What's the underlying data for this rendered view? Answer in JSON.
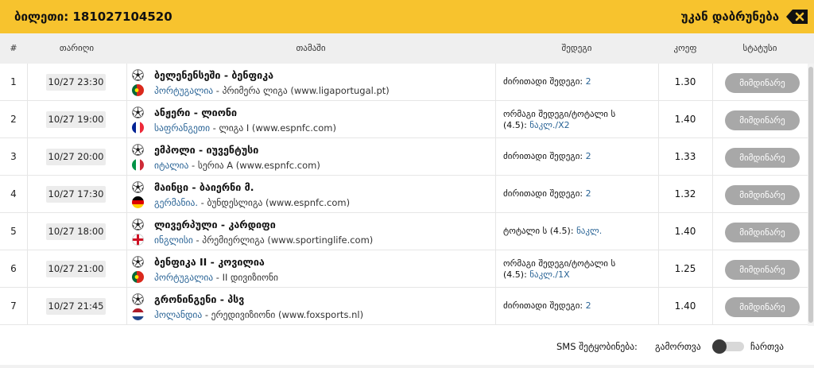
{
  "header": {
    "ticket": "ბილეთი: 181027104520",
    "back_label": "უკან დაბრუნება",
    "back_icon": "backspace-icon"
  },
  "columns": {
    "num": "#",
    "date": "თარიღი",
    "match": "თამაში",
    "result": "შედეგი",
    "coef": "კოეფ",
    "status": "სტატუსი"
  },
  "rows": [
    {
      "num": "1",
      "date": "10/27 23:30",
      "match": "ბელენენსეში - ბენფიკა",
      "country": "პორტუგალია",
      "league": " - პრიმერა ლიგა (www.ligaportugal.pt)",
      "flag": "portugal",
      "res1": "ძირითადი შედეგი: ",
      "val1": "2",
      "res2": "",
      "val2": "",
      "coef": "1.30",
      "status": "მიმდინარე"
    },
    {
      "num": "2",
      "date": "10/27 19:00",
      "match": "ანჟერი - ლიონი",
      "country": "საფრანგეთი",
      "league": " - ლიგა I (www.espnfc.com)",
      "flag": "france",
      "res1": "ორმაგი შედეგი/ტოტალი ს",
      "val1": "",
      "res2": "(4.5): ",
      "val2": "ნაკლ./X2",
      "coef": "1.40",
      "status": "მიმდინარე"
    },
    {
      "num": "3",
      "date": "10/27 20:00",
      "match": "ემპოლი - იუვენტუსი",
      "country": "იტალია",
      "league": " - სერია A (www.espnfc.com)",
      "flag": "italy",
      "res1": "ძირითადი შედეგი: ",
      "val1": "2",
      "res2": "",
      "val2": "",
      "coef": "1.33",
      "status": "მიმდინარე"
    },
    {
      "num": "4",
      "date": "10/27 17:30",
      "match": "მაინცი - ბაიერნი მ.",
      "country": "გერმანია.",
      "league": " - ბუნდესლიგა (www.espnfc.com)",
      "flag": "germany",
      "res1": "ძირითადი შედეგი: ",
      "val1": "2",
      "res2": "",
      "val2": "",
      "coef": "1.32",
      "status": "მიმდინარე"
    },
    {
      "num": "5",
      "date": "10/27 18:00",
      "match": "ლივერპული - კარდიფი",
      "country": "ინგლისი",
      "league": " - პრემიერლიგა (www.sportinglife.com)",
      "flag": "england",
      "res1": "ტოტალი ს (4.5): ",
      "val1": "ნაკლ.",
      "res2": "",
      "val2": "",
      "coef": "1.40",
      "status": "მიმდინარე"
    },
    {
      "num": "6",
      "date": "10/27 21:00",
      "match": "ბენფიკა II - კოვილია",
      "country": "პორტუგალია",
      "league": " - II დივიზიონი",
      "flag": "portugal",
      "res1": "ორმაგი შედეგი/ტოტალი ს",
      "val1": "",
      "res2": "(4.5): ",
      "val2": "ნაკლ./1X",
      "coef": "1.25",
      "status": "მიმდინარე"
    },
    {
      "num": "7",
      "date": "10/27 21:45",
      "match": "გრონინგენი - პსვ",
      "country": "ჰოლანდია",
      "league": " - ერედივიზიონი (www.foxsports.nl)",
      "flag": "netherlands",
      "res1": "ძირითადი შედეგი: ",
      "val1": "2",
      "res2": "",
      "val2": "",
      "coef": "1.40",
      "status": "მიმდინარე"
    }
  ],
  "footer": {
    "sms_label": "SMS შეტყობინება:",
    "off_label": "გამორთვა",
    "on_label": "ჩართვა",
    "toggle_state": "off"
  }
}
